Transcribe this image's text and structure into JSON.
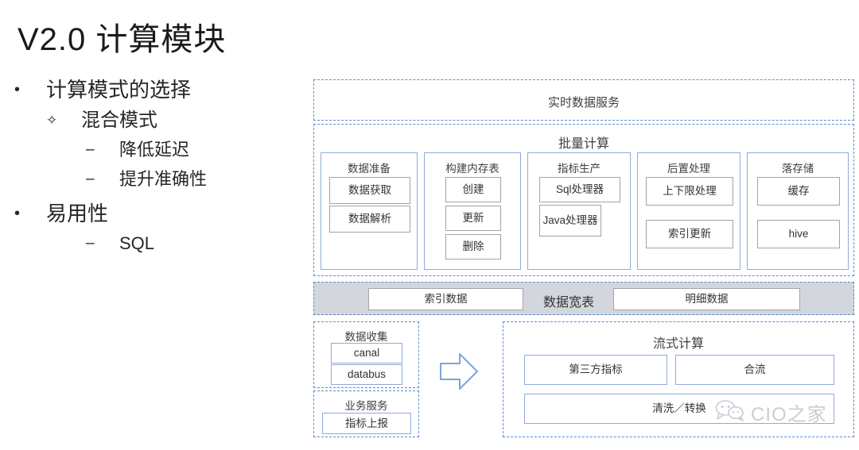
{
  "slide": {
    "title": "V2.0 计算模块"
  },
  "outline": [
    {
      "level": 1,
      "marker": "•",
      "text": "计算模式的选择"
    },
    {
      "level": 2,
      "marker": "✧",
      "text": "混合模式"
    },
    {
      "level": 3,
      "marker": "–",
      "text": "降低延迟"
    },
    {
      "level": 3,
      "marker": "–",
      "text": "提升准确性"
    },
    {
      "level": 1,
      "marker": "•",
      "text": "易用性"
    },
    {
      "level": 3,
      "marker": "–",
      "text": "SQL"
    }
  ],
  "diagram": {
    "realtime_service": {
      "title": "实时数据服务"
    },
    "batch": {
      "title": "批量计算",
      "columns": [
        {
          "title": "数据准备",
          "items": [
            "数据获取",
            "数据解析"
          ]
        },
        {
          "title": "构建内存表",
          "items": [
            "创建",
            "更新",
            "删除"
          ]
        },
        {
          "title": "指标生产",
          "items": [
            "Sql处理器",
            "Java处理器"
          ]
        },
        {
          "title": "后置处理",
          "items": [
            "上下限处理",
            "索引更新"
          ]
        },
        {
          "title": "落存储",
          "items": [
            "缓存",
            "hive"
          ]
        }
      ]
    },
    "wide_table": {
      "center_label": "数据宽表",
      "left_box": "索引数据",
      "right_box": "明细数据"
    },
    "collect": {
      "title": "数据收集",
      "items": [
        "canal",
        "databus"
      ]
    },
    "business": {
      "title": "业务服务",
      "items": [
        "指标上报"
      ]
    },
    "arrow": {
      "icon": "right-arrow-icon"
    },
    "stream": {
      "title": "流式计算",
      "row1": [
        "第三方指标",
        "合流"
      ],
      "row2": [
        "清洗／转换"
      ]
    }
  },
  "watermark": {
    "icon": "wechat-bubbles-icon",
    "text": "CIO之家"
  },
  "colors": {
    "dashed_border": "#5b8bd0",
    "box_border_blue": "#8faadc",
    "box_border_gray": "#a3a3a3",
    "band_gray": "#d3d7dd",
    "text": "#333333",
    "watermark": "#c9cdd4"
  }
}
